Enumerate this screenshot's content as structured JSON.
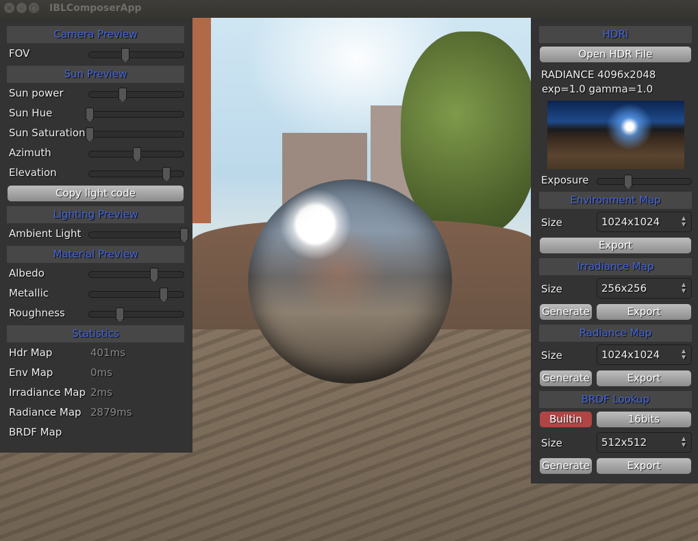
{
  "window": {
    "title": "IBLComposerApp",
    "buttons": [
      "close",
      "minimize",
      "maximize"
    ]
  },
  "left_panel": {
    "camera_header": "Camera Preview",
    "fov": {
      "label": "FOV",
      "value": 0.38
    },
    "sun_header": "Sun Preview",
    "sun_sliders": [
      {
        "label": "Sun power",
        "value": 0.35
      },
      {
        "label": "Sun Hue",
        "value": 0.0
      },
      {
        "label": "Sun Saturation",
        "value": 0.0
      },
      {
        "label": "Azimuth",
        "value": 0.5
      },
      {
        "label": "Elevation",
        "value": 0.81
      }
    ],
    "copy_light_code": "Copy light code",
    "lighting_header": "Lighting Preview",
    "ambient": {
      "label": "Ambient Light",
      "value": 1.0
    },
    "material_header": "Material Preview",
    "material_sliders": [
      {
        "label": "Albedo",
        "value": 0.68
      },
      {
        "label": "Metallic",
        "value": 0.78
      },
      {
        "label": "Roughness",
        "value": 0.32
      }
    ],
    "statistics_header": "Statistics",
    "stats": [
      {
        "label": "Hdr Map",
        "value": "401ms"
      },
      {
        "label": "Env Map",
        "value": "0ms"
      },
      {
        "label": "Irradiance Map",
        "value": "2ms"
      },
      {
        "label": "Radiance Map",
        "value": "2879ms"
      },
      {
        "label": "BRDF Map",
        "value": ""
      }
    ]
  },
  "right_panel": {
    "hdri_header": "HDRi",
    "open_hdr": "Open HDR File",
    "info_line1": "RADIANCE 4096x2048",
    "info_line2": "exp=1.0 gamma=1.0",
    "exposure": {
      "label": "Exposure",
      "value": 0.32
    },
    "env_header": "Environment Map",
    "env_size_label": "Size",
    "env_size": "1024x1024",
    "env_export": "Export",
    "irr_header": "Irradiance Map",
    "irr_size_label": "Size",
    "irr_size": "256x256",
    "irr_generate": "Generate",
    "irr_export": "Export",
    "rad_header": "Radiance Map",
    "rad_size_label": "Size",
    "rad_size": "1024x1024",
    "rad_generate": "Generate",
    "rad_export": "Export",
    "brdf_header": "BRDF Lookup",
    "brdf_builtin": "Builtin",
    "brdf_bits": "16bits",
    "brdf_size_label": "Size",
    "brdf_size": "512x512",
    "brdf_generate": "Generate",
    "brdf_export": "Export",
    "colors": {
      "accent_header_text": "#4466dd",
      "builtin_active": "#b04545"
    }
  }
}
